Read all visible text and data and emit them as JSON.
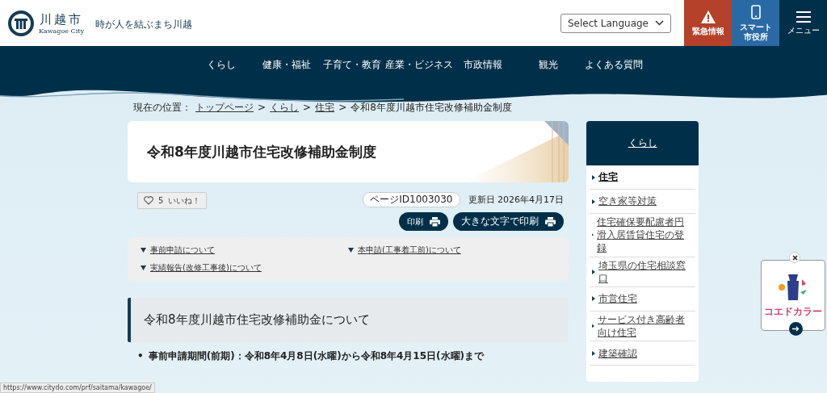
{
  "header": {
    "logo_name": "川越市",
    "logo_sub": "Kawagoe City",
    "tagline": "時が人を結ぶまち川越",
    "language": "Select Language",
    "buttons": [
      {
        "kind": "alert",
        "label": "緊急情報"
      },
      {
        "kind": "phone",
        "label": "スマート市役所"
      },
      {
        "kind": "menu",
        "label": "メニュー"
      }
    ]
  },
  "nav": [
    "くらし",
    "健康・福祉",
    "子育て・教育",
    "産業・ビジネス",
    "市政情報",
    "観光",
    "よくある質問"
  ],
  "breadcrumb": {
    "label": "現在の位置：",
    "links": [
      "トップページ",
      "くらし",
      "住宅"
    ],
    "separator": ">",
    "current": "令和8年度川越市住宅改修補助金制度"
  },
  "page_title": "令和8年度川越市住宅改修補助金制度",
  "like": {
    "count": "5",
    "label": "いいね！"
  },
  "page_id": "ページID1003030",
  "updated": "更新日 2026年4月17日",
  "print_buttons": [
    "印刷",
    "大きな文字で印刷"
  ],
  "toc": [
    "事前申請について",
    "本申請(工事着工前)について",
    "実績報告(改修工事後)について"
  ],
  "section_heading": "令和8年度川越市住宅改修補助金について",
  "bullet_marker": "•",
  "bullets": [
    "事前申請期間(前期)：令和8年4月8日(水曜)から令和8年4月15日(水曜)まで"
  ],
  "sidebar": {
    "title": "くらし",
    "items": [
      {
        "label": "住宅",
        "selected": true
      },
      {
        "label": "空き家等対策",
        "selected": false
      },
      {
        "label": "住宅確保要配慮者円滑入居賃貸住宅の登録",
        "selected": false
      },
      {
        "label": "埼玉県の住宅相談窓口",
        "selected": false
      },
      {
        "label": "市営住宅",
        "selected": false
      },
      {
        "label": "サービス付き高齢者向け住宅",
        "selected": false
      },
      {
        "label": "建築確認",
        "selected": false
      }
    ]
  },
  "banner": {
    "label": "コエドカラー"
  },
  "status_bar": "https://www.citydo.com/prf/saitama/kawagoe/"
}
